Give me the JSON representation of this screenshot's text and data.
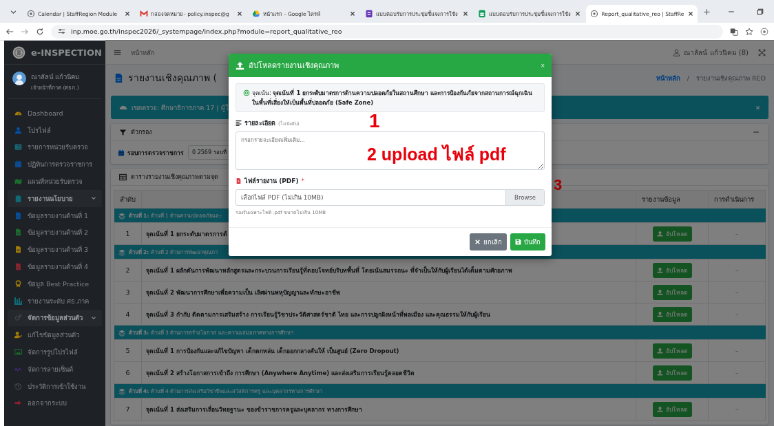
{
  "browser": {
    "tabs": [
      {
        "title": "Calendar | StaffRegion Module",
        "kind": "globe",
        "selected": false
      },
      {
        "title": "กล่องจดหมาย - policy.inspec@g",
        "kind": "mail",
        "selected": false
      },
      {
        "title": "หน้าแรก - Google ไดรฟ์",
        "kind": "drive",
        "selected": false
      },
      {
        "title": "แบบตอบรับการประชุมชี้แจงการใช้ง",
        "kind": "forms",
        "selected": false
      },
      {
        "title": "แบบตอบรับการประชุมชี้แจงการใช้ง",
        "kind": "sheets",
        "selected": false
      },
      {
        "title": "Report_qualitative_reo | StaffRe",
        "kind": "globe",
        "selected": true
      }
    ],
    "url": "inp.moe.go.th/inspec2026/_systempage/index.php?module=report_qualitative_reo"
  },
  "sidebar": {
    "brand": "e-INSPECTION",
    "user": {
      "name": "ณาลัลน์ แก้วนิคม",
      "role": "เจ้าหน้าที่ภาค (ศธภ.)"
    },
    "items": [
      {
        "label": "Dashboard",
        "kind": "gauge",
        "color": "#a67d05"
      },
      {
        "label": "โปรไฟล์",
        "kind": "user",
        "color": "#0050a6"
      },
      {
        "label": "รายการหน่วยรับตรวจ",
        "kind": "list",
        "color": "#0f6977"
      },
      {
        "label": "ปฏิทินการตรวจราชการ",
        "kind": "calendar",
        "color": "#0050a6"
      },
      {
        "label": "แผนที่หน่วยรับตรวจ",
        "kind": "map",
        "color": "#1a6d2d"
      },
      {
        "label": "รายงานนโยบาย",
        "kind": "clipboard",
        "color": "#0f6977",
        "expanded": true,
        "children": [
          {
            "label": "ข้อมูลรายงานด้านที่ 1",
            "kind": "file",
            "color": "#0050a6"
          },
          {
            "label": "ข้อมูลรายงานด้านที่ 2",
            "kind": "file",
            "color": "#1a6d2d"
          },
          {
            "label": "ข้อมูลรายงานด้านที่ 3",
            "kind": "file",
            "color": "#a67d05"
          },
          {
            "label": "ข้อมูลรายงานด้านที่ 4",
            "kind": "file",
            "color": "#8f222d"
          },
          {
            "label": "ข้อมูล Best Practice",
            "kind": "award",
            "color": "#a67d05"
          },
          {
            "label": "รายงานระดับ ศธ.ภาค",
            "kind": "chart",
            "color": "#0f6977"
          }
        ]
      },
      {
        "label": "จัดการข้อมูลส่วนตัว",
        "kind": "gears",
        "color": "#464c51",
        "expanded": true,
        "children": [
          {
            "label": "แก้ไขข้อมูลส่วนตัว",
            "kind": "useredit",
            "color": "#a67d05"
          },
          {
            "label": "จัดการรูปโปรไฟล์",
            "kind": "image",
            "color": "#1a6d2d"
          },
          {
            "label": "จัดการลายเซ็นต์",
            "kind": "signature",
            "color": "#48297d"
          },
          {
            "label": "ประวัติการเข้าใช้งาน",
            "kind": "history",
            "color": "#464c51"
          },
          {
            "label": "ออกจากระบบ",
            "kind": "signout",
            "color": "#8f222d"
          }
        ]
      }
    ]
  },
  "topbar": {
    "home": "หน้าหลัก",
    "user": "ณาลัลน์ แก้วนิคม (8)"
  },
  "page": {
    "title": "รายงานเชิงคุณภาพ (",
    "breadcrumb": [
      "หน้าหลัก",
      "รายงานเชิงคุณภาพ REO"
    ],
    "breadcrumb_separator": "/"
  },
  "alert": {
    "text": "เขตตรวจ: ศึกษาธิการภาค 17 | ผู้ใ"
  },
  "filter": {
    "title": "ตัวกรอง",
    "round_label": "รอบการตรวจราชการ",
    "round_value": "0 2569 รอบที่"
  },
  "table": {
    "title": "ตารางรายงานเชิงคุณภาพตามจุด",
    "columns": [
      "ลำดับ",
      "รายงานข้อมูล",
      "การดำเนินการ"
    ],
    "rows": [
      {
        "kind": "group",
        "label": "ด้านที่ 1:",
        "text": "ด้านที่ 1 ด้านความปลอดภัยและ"
      },
      {
        "kind": "item",
        "no": "1",
        "text": "จุดเน้นที่ 1 ยกระดับมาตรการด้",
        "button": "อัปโหลด",
        "action": "–"
      },
      {
        "kind": "group",
        "label": "ด้านที่ 2:",
        "text": "ด้านที่ 2 ด้านการพัฒนาคุณภา"
      },
      {
        "kind": "item",
        "no": "2",
        "text": "จุดเน้นที่ 1 ผลักดันการพัฒนาหลักสูตรและกระบวนการเรียนรู้ที่ตอบโจทย์บริบทพื้นที่ โดยเน้นสมรรถนะ ที่จำเป็นให้กับผู้เรียนได้เต็มตามศักยภาพ",
        "button": "อัปโหลด",
        "action": "–"
      },
      {
        "kind": "item",
        "no": "3",
        "text": "จุดเน้นที่ 2 พัฒนาการศึกษาเพื่อความเป็น เลิศผ่านพหุปัญญาและทักษะอาชีพ",
        "button": "อัปโหลด",
        "action": "–"
      },
      {
        "kind": "item",
        "no": "4",
        "text": "จุดเน้นที่ 3 กำกับ ติดตามการเสริมสร้าง การเรียนรู้วิชาประวัติศาสตร์ชาติ ไทย และการปลูกฝังหน้าที่พลเมือง และคุณธรรมให้กับผู้เรียน",
        "button": "อัปโหลด",
        "action": "–"
      },
      {
        "kind": "group",
        "label": "ด้านที่ 3:",
        "text": "ด้านที่ 3 ด้านการสร้างโอกาส และความเสมอภาคทางการศึกษา"
      },
      {
        "kind": "item",
        "no": "5",
        "text": "จุดเน้นที่ 1 การป้องกันและแก้ไขปัญหา เด็กตกหล่น เด็กออกกลางคันให้ เป็นศูนย์ (Zero Dropout)",
        "button": "อัปโหลด",
        "action": "–"
      },
      {
        "kind": "item",
        "no": "6",
        "text": "จุดเน้นที่ 2 สร้างโอกาสการเข้าถึง การศึกษา (Anywhere Anytime) และส่งเสริมการเรียนรู้ตลอดชีวิต",
        "button": "อัปโหลด",
        "action": "–"
      },
      {
        "kind": "group",
        "label": "ด้านที่ 4:",
        "text": "ด้านที่ 4 ด้านการส่งเสริมวิชาชีพและสวัสดิการครู และบุคลากรทางการศึกษา"
      },
      {
        "kind": "item",
        "no": "7",
        "text": "จุดเน้นที่ 1 ส่งเสริมการเลื่อนวิทยฐานะ ของข้าราชการครูและบุคลากร ทางการศึกษา",
        "button": "อัปโหลด",
        "action": "–"
      }
    ]
  },
  "modal": {
    "title": "อัปโหลดรายงานเชิงคุณภาพ",
    "close": "×",
    "focus": "จุดเน้น: **จุดเน้นที่ 1 ยกระดับมาตรการด้านความปลอดภัยในสถานศึกษา และการป้องกันภัยจากสถานการณ์ฉุกเฉิน ในพื้นที่เสี่ยงให้เป็นพื้นที่ปลอดภัย (Safe Zone)**",
    "detail_label": "รายละเอียด",
    "detail_hint": "(ไม่บังคับ)",
    "detail_placeholder": "กรอกรายละเอียดเพิ่มเติม...",
    "file_label": "ไฟล์รายงาน (PDF)",
    "file_required": "*",
    "file_placeholder": "เลือกไฟล์ PDF (ไม่เกิน 10MB)",
    "browse": "Browse",
    "file_help": "รองรับเฉพาะไฟล์ .pdf ขนาดไม่เกิน 10MB",
    "buttons": [
      "ยกเลิก",
      "บันทึก"
    ]
  },
  "annotations": [
    "1",
    "2 upload ไฟล์ pdf",
    "3"
  ]
}
